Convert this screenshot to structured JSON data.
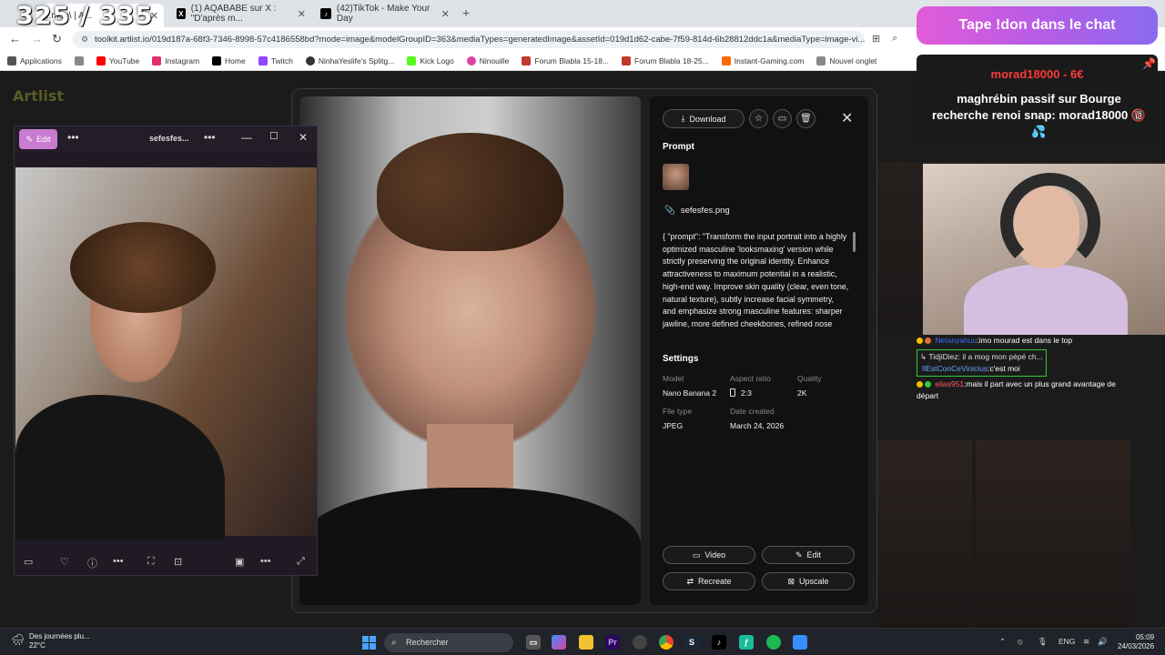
{
  "overlay_counter": "325 / 335",
  "tabs": [
    {
      "label": "...moo\\ | A...",
      "icon": "artlist-icon",
      "active": true
    },
    {
      "label": "(1) AQABABE sur X : \"D'après m...",
      "icon": "x-icon"
    },
    {
      "label": "(42)TikTok - Make Your Day",
      "icon": "tiktok-icon"
    }
  ],
  "address": {
    "url": "toolkit.artlist.io/019d187a-68f3-7346-8998-57c4186558bd?mode=image&modelGroupID=363&mediaTypes=generatedImage&assetId=019d1d62-cabe-7f59-814d-6b28812ddc1a&mediaType=image-vi..."
  },
  "bookmarks": [
    {
      "label": "Applications",
      "color": "#555"
    },
    {
      "label": "YouTube",
      "color": "#ff0000"
    },
    {
      "label": "Instagram",
      "color": "#e1306c"
    },
    {
      "label": "Home",
      "color": "#000000"
    },
    {
      "label": "Twitch",
      "color": "#9146ff"
    },
    {
      "label": "NinhaYeslife's Splitg...",
      "color": "#333"
    },
    {
      "label": "Kick Logo",
      "color": "#53fc18"
    },
    {
      "label": "Ninouille",
      "color": "#e040a0"
    },
    {
      "label": "Forum Blabla 15-18...",
      "color": "#c0392b"
    },
    {
      "label": "Forum Blabla 18-25...",
      "color": "#c0392b"
    },
    {
      "label": "Instant-Gaming.com",
      "color": "#ff6600"
    },
    {
      "label": "Nouvel onglet",
      "color": "#888"
    }
  ],
  "app": {
    "logo": "Artlist"
  },
  "modal": {
    "download": "Download",
    "prompt_heading": "Prompt",
    "file_name": "sefesfes.png",
    "prompt_text": "{ \"prompt\": \"Transform the input portrait into a highly optimized masculine 'looksmaxing' version while strictly preserving the original identity. Enhance attractiveness to maximum potential in a realistic, high-end way. Improve skin quality (clear, even tone, natural texture), subtly increase facial symmetry, and emphasize strong masculine features: sharper jawline, more defined cheekbones, refined nose",
    "settings_heading": "Settings",
    "settings": {
      "model_label": "Model",
      "model_value": "Nano Banana 2",
      "aspect_label": "Aspect ratio",
      "aspect_value": "2:3",
      "quality_label": "Quality",
      "quality_value": "2K",
      "filetype_label": "File type",
      "filetype_value": "JPEG",
      "date_label": "Date created",
      "date_value": "March 24, 2026"
    },
    "actions": {
      "video": "Video",
      "edit": "Edit",
      "recreate": "Recreate",
      "upscale": "Upscale"
    }
  },
  "viewer": {
    "edit": "Edit",
    "title": "sefesfes..."
  },
  "stream": {
    "don_banner": "Tape !don dans le chat",
    "donor": "morad18000 - 6€",
    "donation_message": "maghrébin passif sur Bourge recherche renoi snap: morad18000 🔞 💦",
    "chat": [
      {
        "user": "Netanyahuu",
        "message": "imo mourad est dans le top"
      },
      {
        "reply_to": "TidjiDiez: il a mog mon pépé ch..."
      },
      {
        "user": "IlEstConCeVinicius",
        "message": "c'est moi"
      },
      {
        "user": "elias951",
        "message": "mais il part avec un plus grand avantage de"
      },
      {
        "message_cont": "départ"
      }
    ]
  },
  "taskbar": {
    "weather_text": "Des journées plu...",
    "temperature": "22°C",
    "search_placeholder": "Rechercher",
    "lang": "ENG",
    "time": "05:09",
    "date": "24/03/2026"
  }
}
